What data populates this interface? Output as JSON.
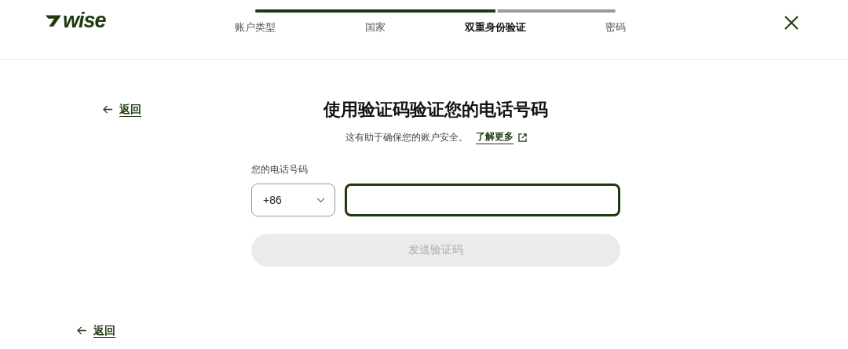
{
  "logo": {
    "text": "wise"
  },
  "steps": [
    {
      "label": "账户类型",
      "selected": false
    },
    {
      "label": "国家",
      "selected": false
    },
    {
      "label": "双重身份验证",
      "selected": true
    },
    {
      "label": "密码",
      "selected": false
    }
  ],
  "progress": {
    "level": 0.667
  },
  "back_link": {
    "label": "返回"
  },
  "title": "使用验证码验证您的电话号码",
  "subtitle": "这有助于确保您的账户安全。",
  "learn_more": {
    "label": "了解更多"
  },
  "phone": {
    "label": "您的电话号码",
    "country_code": "+86",
    "focused": true
  },
  "send_button": {
    "label": "发送验证码",
    "disabled": true
  },
  "footer_back_link": {
    "label": "返回"
  }
}
